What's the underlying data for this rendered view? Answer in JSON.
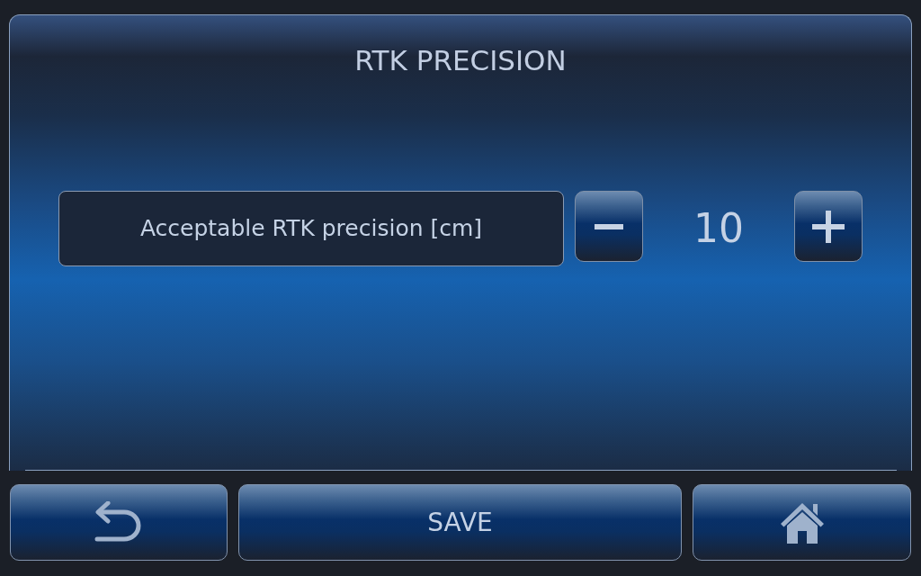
{
  "screen": {
    "title": "RTK PRECISION"
  },
  "setting": {
    "label": "Acceptable RTK precision [cm]",
    "value": "10"
  },
  "buttons": [
    {
      "kind": "back"
    },
    {
      "kind": "save",
      "label": "SAVE"
    },
    {
      "kind": "home"
    }
  ]
}
